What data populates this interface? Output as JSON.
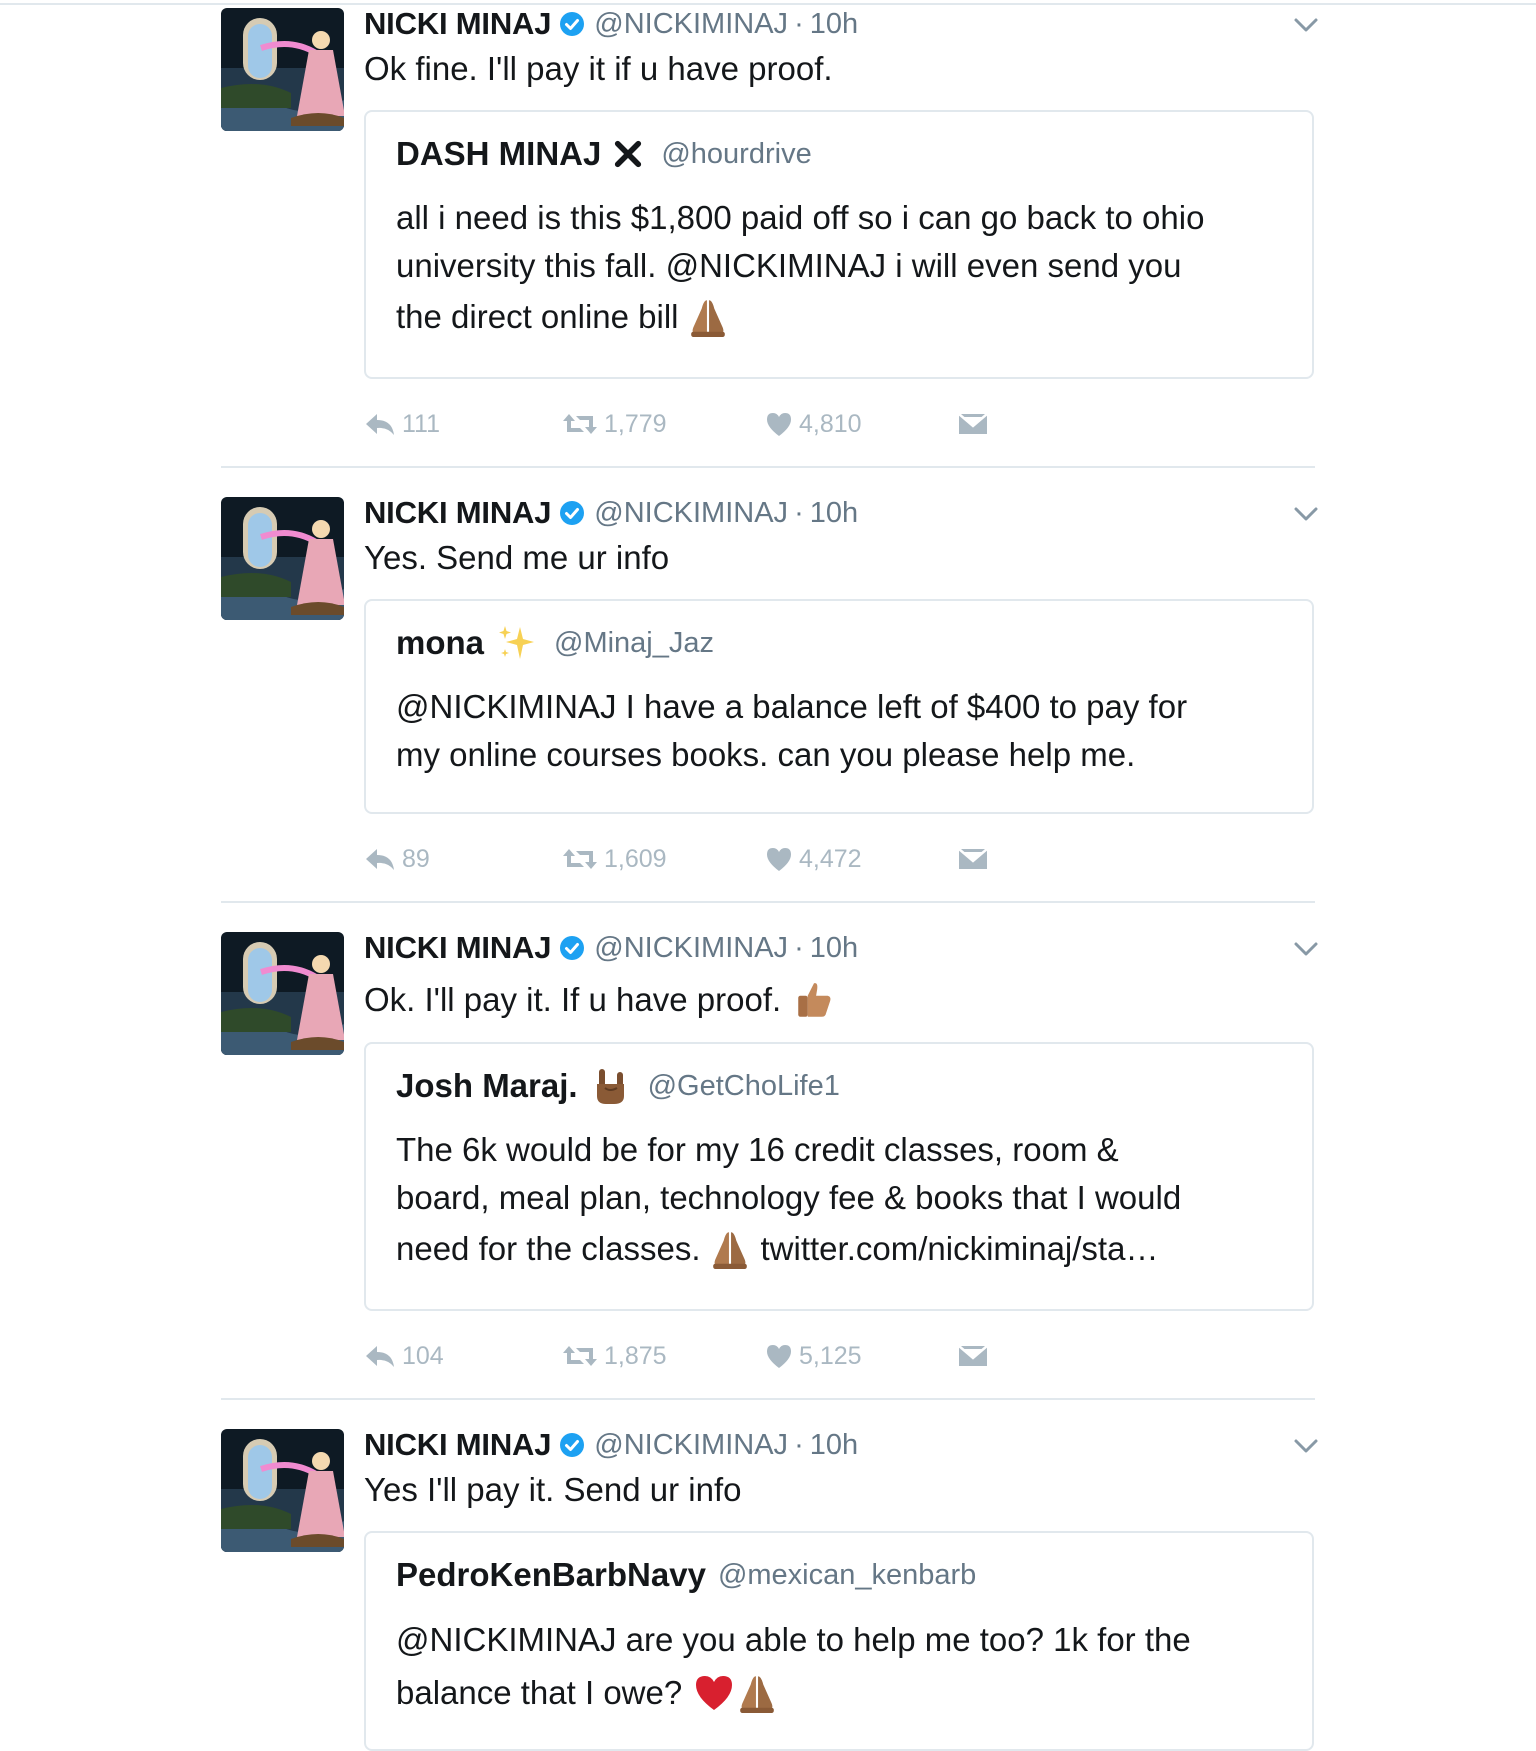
{
  "colors": {
    "text": "#14171a",
    "secondary": "#657786",
    "action": "#aab8c2",
    "verified": "#1da1f2",
    "divider": "#e1e8ed"
  },
  "tweets": [
    {
      "author": {
        "name": "NICKI MINAJ",
        "handle": "@NICKIMINAJ",
        "time": "10h",
        "verified": true
      },
      "text": "Ok fine. I'll pay it if u have proof.",
      "quote": {
        "name": "DASH MINAJ",
        "name_emoji": "cross-mark-icon",
        "handle": "@hourdrive",
        "lines": [
          "all i need is this $1,800 paid off so i can go back to ohio",
          "university this fall. @NICKIMINAJ i will even send you",
          "the direct online bill"
        ],
        "trailing_emoji": "folded-hands-icon"
      },
      "actions": {
        "replies": "111",
        "retweets": "1,779",
        "likes": "4,810"
      }
    },
    {
      "author": {
        "name": "NICKI MINAJ",
        "handle": "@NICKIMINAJ",
        "time": "10h",
        "verified": true
      },
      "text": "Yes. Send me ur info",
      "quote": {
        "name": "mona",
        "name_emoji": "sparkles-icon",
        "handle": "@Minaj_Jaz",
        "lines": [
          "@NICKIMINAJ I have a balance left of $400 to pay for",
          "my online courses books. can you please help me."
        ]
      },
      "actions": {
        "replies": "89",
        "retweets": "1,609",
        "likes": "4,472"
      }
    },
    {
      "author": {
        "name": "NICKI MINAJ",
        "handle": "@NICKIMINAJ",
        "time": "10h",
        "verified": true
      },
      "text": "Ok. I'll pay it. If u have proof.",
      "text_emoji": "thumbs-up-icon",
      "quote": {
        "name": "Josh Maraj.",
        "name_emoji": "rock-on-hand-icon",
        "handle": "@GetChoLife1",
        "lines": [
          "The 6k would be for my 16 credit classes, room &",
          "board, meal plan, technology fee & books that I would",
          "need for the classes."
        ],
        "line3_emoji": "folded-hands-icon",
        "line3_link": "twitter.com/nickiminaj/sta…"
      },
      "actions": {
        "replies": "104",
        "retweets": "1,875",
        "likes": "5,125"
      }
    },
    {
      "author": {
        "name": "NICKI MINAJ",
        "handle": "@NICKIMINAJ",
        "time": "10h",
        "verified": true
      },
      "text": "Yes I'll pay it. Send ur info",
      "quote": {
        "name": "PedroKenBarbNavy",
        "handle": "@mexican_kenbarb",
        "lines": [
          "@NICKIMINAJ are you able to help me too? 1k for the",
          "balance that I owe?"
        ],
        "trailing_emojis": [
          "red-heart-icon",
          "folded-hands-icon"
        ]
      }
    }
  ]
}
